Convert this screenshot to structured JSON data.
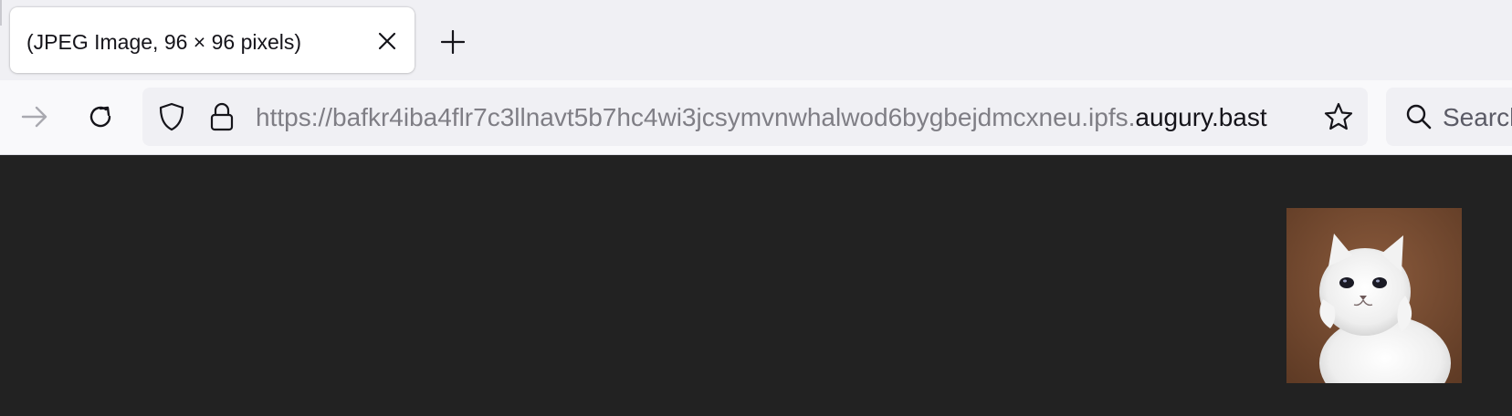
{
  "browser": {
    "tab": {
      "title": "(JPEG Image, 96 × 96 pixels)",
      "close_icon": "close-icon"
    },
    "new_tab_icon": "plus-icon",
    "navbar": {
      "forward_icon": "arrow-right-icon",
      "reload_icon": "reload-icon",
      "url": {
        "shield_icon": "shield-icon",
        "lock_icon": "lock-icon",
        "prefix": "https://bafkr4iba4flr7c3llnavt5b7hc4wi3jcsymvnwhalwod6bygbejdmcxneu.ipfs.",
        "domain": "augury.bast",
        "star_icon": "star-icon"
      },
      "search": {
        "icon": "search-icon",
        "placeholder": "Search"
      }
    }
  },
  "content": {
    "background": "#222222",
    "image": {
      "subject": "white-persian-cat-photo"
    }
  },
  "colors": {
    "tabstrip": "#f0f0f4",
    "toolbar": "#f9f9fb",
    "field": "#f0f0f4",
    "text": "#15141a",
    "muted_text": "#7f7e85"
  }
}
